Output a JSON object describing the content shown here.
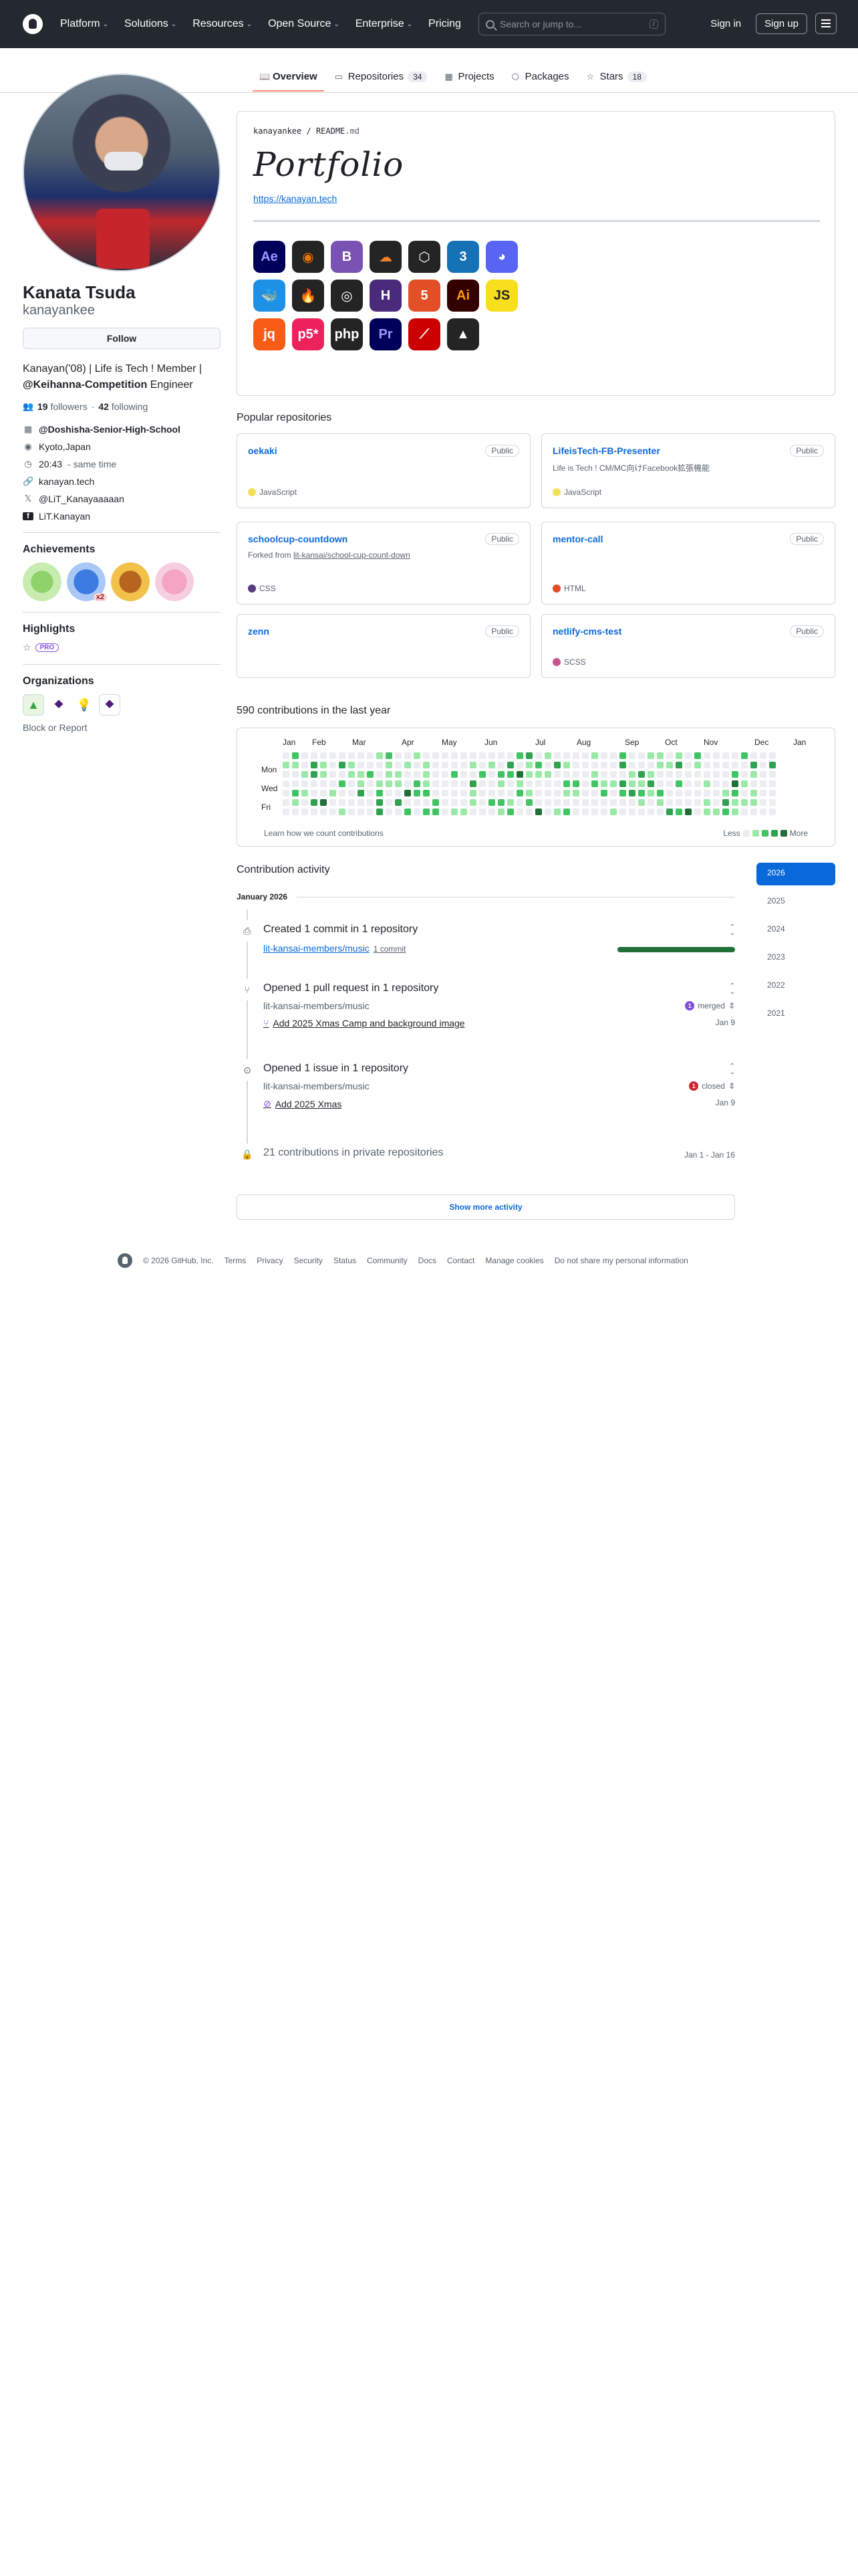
{
  "header": {
    "nav": [
      "Platform",
      "Solutions",
      "Resources",
      "Open Source",
      "Enterprise",
      "Pricing"
    ],
    "search_placeholder": "Search or jump to...",
    "search_key": "/",
    "sign_in": "Sign in",
    "sign_up": "Sign up"
  },
  "tabs": [
    {
      "label": "Overview",
      "count": "",
      "icon": "book-icon"
    },
    {
      "label": "Repositories",
      "count": "34",
      "icon": "repo-icon"
    },
    {
      "label": "Projects",
      "count": "",
      "icon": "table-icon"
    },
    {
      "label": "Packages",
      "count": "",
      "icon": "package-icon"
    },
    {
      "label": "Stars",
      "count": "18",
      "icon": "star-icon"
    }
  ],
  "profile": {
    "name": "Kanata Tsuda",
    "login": "kanayankee",
    "follow": "Follow",
    "bio_1": "Kanayan('08) | Life is Tech ! Member | ",
    "bio_org": "@Keihanna-Competition",
    "bio_2": " Engineer",
    "followers_count": "19",
    "followers_label": "followers",
    "sep": "·",
    "following_count": "42",
    "following_label": "following",
    "company": "@Doshisha-Senior-High-School",
    "location": "Kyoto,Japan",
    "time": "20:43",
    "time_note": "- same time",
    "website": "kanayan.tech",
    "twitter": "@LiT_Kanayaaaaan",
    "facebook": "LiT.Kanayan",
    "achievements_h": "Achievements",
    "achievement_x2": "x2",
    "highlights_h": "Highlights",
    "pro": "PRO",
    "organizations_h": "Organizations",
    "block": "Block or Report"
  },
  "readme": {
    "path_user": "kanayankee",
    "path_sep": " / ",
    "path_file": "README",
    "path_ext": ".md",
    "title": "Portfolio",
    "link": "https://kanayan.tech",
    "icons": [
      {
        "name": "after-effects-icon",
        "label": "Ae",
        "bg": "#00005b",
        "fg": "#9999ff"
      },
      {
        "name": "blender-icon",
        "label": "◉",
        "bg": "#242424",
        "fg": "#ea7600"
      },
      {
        "name": "bootstrap-icon",
        "label": "B",
        "bg": "#7952b3",
        "fg": "#ffffff"
      },
      {
        "name": "cloudflare-icon",
        "label": "☁",
        "bg": "#242424",
        "fg": "#f38020"
      },
      {
        "name": "codepen-icon",
        "label": "⬡",
        "bg": "#242424",
        "fg": "#ffffff"
      },
      {
        "name": "css3-icon",
        "label": "3",
        "bg": "#1572b6",
        "fg": "#ffffff"
      },
      {
        "name": "discord-icon",
        "label": "◕",
        "bg": "#5865f2",
        "fg": "#ffffff"
      },
      {
        "name": "docker-icon",
        "label": "🐳",
        "bg": "#1d91e6",
        "fg": "#ffffff"
      },
      {
        "name": "firebase-icon",
        "label": "🔥",
        "bg": "#242424",
        "fg": "#ffca28"
      },
      {
        "name": "github-icon",
        "label": "◎",
        "bg": "#242424",
        "fg": "#ffffff"
      },
      {
        "name": "hexo-icon",
        "label": "H",
        "bg": "#4a2a7a",
        "fg": "#ffffff"
      },
      {
        "name": "html5-icon",
        "label": "5",
        "bg": "#e34f26",
        "fg": "#ffffff"
      },
      {
        "name": "illustrator-icon",
        "label": "Ai",
        "bg": "#330000",
        "fg": "#ff9a00"
      },
      {
        "name": "javascript-icon",
        "label": "JS",
        "bg": "#f7df1e",
        "fg": "#242424"
      },
      {
        "name": "jquery-icon",
        "label": "jq",
        "bg": "#f85c17",
        "fg": "#ffffff"
      },
      {
        "name": "p5js-icon",
        "label": "p5*",
        "bg": "#ed225d",
        "fg": "#ffffff"
      },
      {
        "name": "php-icon",
        "label": "php",
        "bg": "#242424",
        "fg": "#ffffff"
      },
      {
        "name": "premiere-icon",
        "label": "Pr",
        "bg": "#00005b",
        "fg": "#9999ff"
      },
      {
        "name": "rails-icon",
        "label": "⟋",
        "bg": "#cc0000",
        "fg": "#ffffff"
      },
      {
        "name": "vercel-icon",
        "label": "▲",
        "bg": "#242424",
        "fg": "#ffffff"
      }
    ]
  },
  "popular": {
    "heading": "Popular repositories",
    "repos": [
      {
        "name": "oekaki",
        "visibility": "Public",
        "desc": "",
        "fork_prefix": "",
        "fork_link": "",
        "lang": "JavaScript",
        "color": "#f1e05a"
      },
      {
        "name": "LifeisTech-FB-Presenter",
        "visibility": "Public",
        "desc": "Life is Tech ! CM/MC向けFacebook拡張機能",
        "fork_prefix": "",
        "fork_link": "",
        "lang": "JavaScript",
        "color": "#f1e05a"
      },
      {
        "name": "schoolcup-countdown",
        "visibility": "Public",
        "desc": "",
        "fork_prefix": "Forked from ",
        "fork_link": "lit-kansai/school-cup-count-down",
        "lang": "CSS",
        "color": "#563d7c"
      },
      {
        "name": "mentor-call",
        "visibility": "Public",
        "desc": "",
        "fork_prefix": "",
        "fork_link": "",
        "lang": "HTML",
        "color": "#e34c26"
      },
      {
        "name": "zenn",
        "visibility": "Public",
        "desc": "",
        "fork_prefix": "",
        "fork_link": "",
        "lang": "",
        "color": ""
      },
      {
        "name": "netlify-cms-test",
        "visibility": "Public",
        "desc": "",
        "fork_prefix": "",
        "fork_link": "",
        "lang": "SCSS",
        "color": "#c6538c"
      }
    ]
  },
  "contributions": {
    "heading": "590 contributions in the last year",
    "months": [
      "Jan",
      "Feb",
      "Mar",
      "Apr",
      "May",
      "Jun",
      "Jul",
      "Aug",
      "Sep",
      "Oct",
      "Nov",
      "Dec",
      "Jan"
    ],
    "days": [
      "Mon",
      "Wed",
      "Fri"
    ],
    "learn": "Learn how we count contributions",
    "less": "Less",
    "more": "More",
    "levels": [
      "#ebedf0",
      "#9be9a8",
      "#40c463",
      "#30a14e",
      "#216e39"
    ]
  },
  "activity": {
    "heading": "Contribution activity",
    "years": [
      "2026",
      "2025",
      "2024",
      "2023",
      "2022",
      "2021"
    ],
    "month": "January 2026",
    "commits_title": "Created 1 commit in 1 repository",
    "commits_repo": "lit-kansai-members/music",
    "commits_count": "1 commit",
    "pr_title": "Opened 1 pull request in 1 repository",
    "pr_repo": "lit-kansai-members/music",
    "pr_status_count": "1",
    "pr_status": "merged",
    "pr_item": "Add 2025 Xmas Camp and background image",
    "pr_date": "Jan 9",
    "issue_title": "Opened 1 issue in 1 repository",
    "issue_repo": "lit-kansai-members/music",
    "issue_status_count": "1",
    "issue_status": "closed",
    "issue_item": "Add 2025 Xmas",
    "issue_date": "Jan 9",
    "private_title": "21 contributions in private repositories",
    "private_dates": "Jan 1 - Jan 16",
    "show_more": "Show more activity"
  },
  "footer": {
    "copyright": "© 2026 GitHub, Inc.",
    "links": [
      "Terms",
      "Privacy",
      "Security",
      "Status",
      "Community",
      "Docs",
      "Contact",
      "Manage cookies",
      "Do not share my personal information"
    ]
  }
}
